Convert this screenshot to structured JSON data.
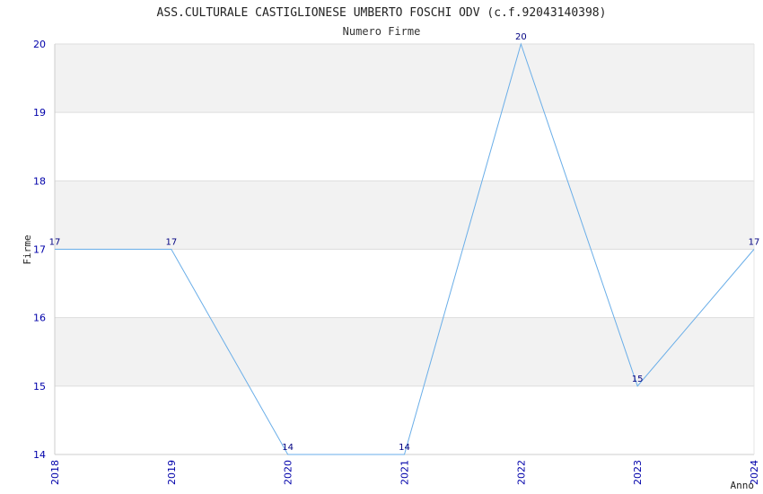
{
  "chart_data": {
    "type": "line",
    "title": "ASS.CULTURALE CASTIGLIONESE UMBERTO FOSCHI ODV (c.f.92043140398)",
    "subtitle": "Numero Firme",
    "xlabel": "Anno",
    "ylabel": "Firme",
    "x": [
      "2018",
      "2019",
      "2020",
      "2021",
      "2022",
      "2023",
      "2024"
    ],
    "series": [
      {
        "values": [
          17,
          17,
          14,
          14,
          20,
          15,
          17
        ]
      }
    ],
    "ylim": [
      14,
      20
    ],
    "yticks": [
      14,
      15,
      16,
      17,
      18,
      19,
      20
    ],
    "grid": true,
    "colors": {
      "line": "#6aaee8",
      "band": "#f2f2f2",
      "gridline": "#dddddd",
      "tick_text": "#0000aa",
      "data_label": "#000080"
    }
  }
}
